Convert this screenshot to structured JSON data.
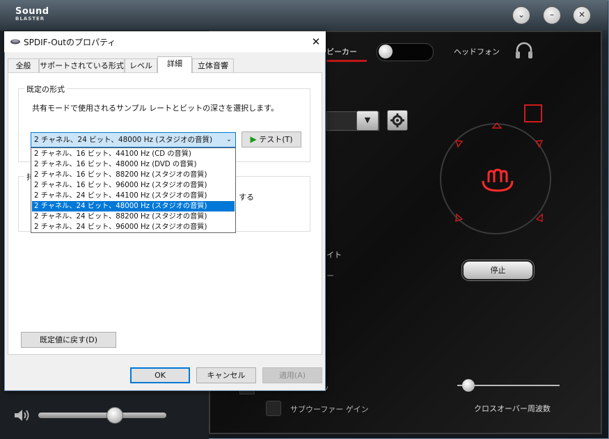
{
  "sound_blaster": {
    "logo_line1": "Sound",
    "logo_line2": "BLASTER",
    "speaker_tab": "ピーカー",
    "headphone_label": "ヘッドフォン",
    "stop_button": "停止",
    "partial_text_1": "イト",
    "partial_text_2": "ー",
    "partial_text_3": "ッ",
    "subwoofer_gain_label": "サブウーファー ゲイン",
    "crossover_label": "クロスオーバー周波数",
    "volume_level": 0.55,
    "crossover_level": 0.12,
    "accent_color": "#d01b1b"
  },
  "dialog": {
    "title": "SPDIF-Outのプロパティ",
    "tabs": [
      {
        "label": "全般",
        "active": false
      },
      {
        "label": "サポートされている形式",
        "active": false
      },
      {
        "label": "レベル",
        "active": false
      },
      {
        "label": "詳細",
        "active": true
      },
      {
        "label": "立体音響",
        "active": false
      }
    ],
    "default_format": {
      "group_title": "既定の形式",
      "description": "共有モードで使用されるサンプル レートとビットの深さを選択します。",
      "selected": "2 チャネル、24 ビット、48000 Hz (スタジオの音質)",
      "test_button": "テスト(T)",
      "options": [
        "2 チャネル、16 ビット、44100 Hz (CD の音質)",
        "2 チャネル、16 ビット、48000 Hz (DVD の音質)",
        "2 チャネル、16 ビット、88200 Hz (スタジオの音質)",
        "2 チャネル、16 ビット、96000 Hz (スタジオの音質)",
        "2 チャネル、24 ビット、44100 Hz (スタジオの音質)",
        "2 チャネル、24 ビット、48000 Hz (スタジオの音質)",
        "2 チャネル、24 ビット、88200 Hz (スタジオの音質)",
        "2 チャネル、24 ビット、96000 Hz (スタジオの音質)"
      ],
      "selected_index": 5
    },
    "exclusive": {
      "group_title_partial": "排",
      "text_partial": "する"
    },
    "reset_button": "既定値に戻す(D)",
    "ok_button": "OK",
    "cancel_button": "キャンセル",
    "apply_button": "適用(A)"
  }
}
